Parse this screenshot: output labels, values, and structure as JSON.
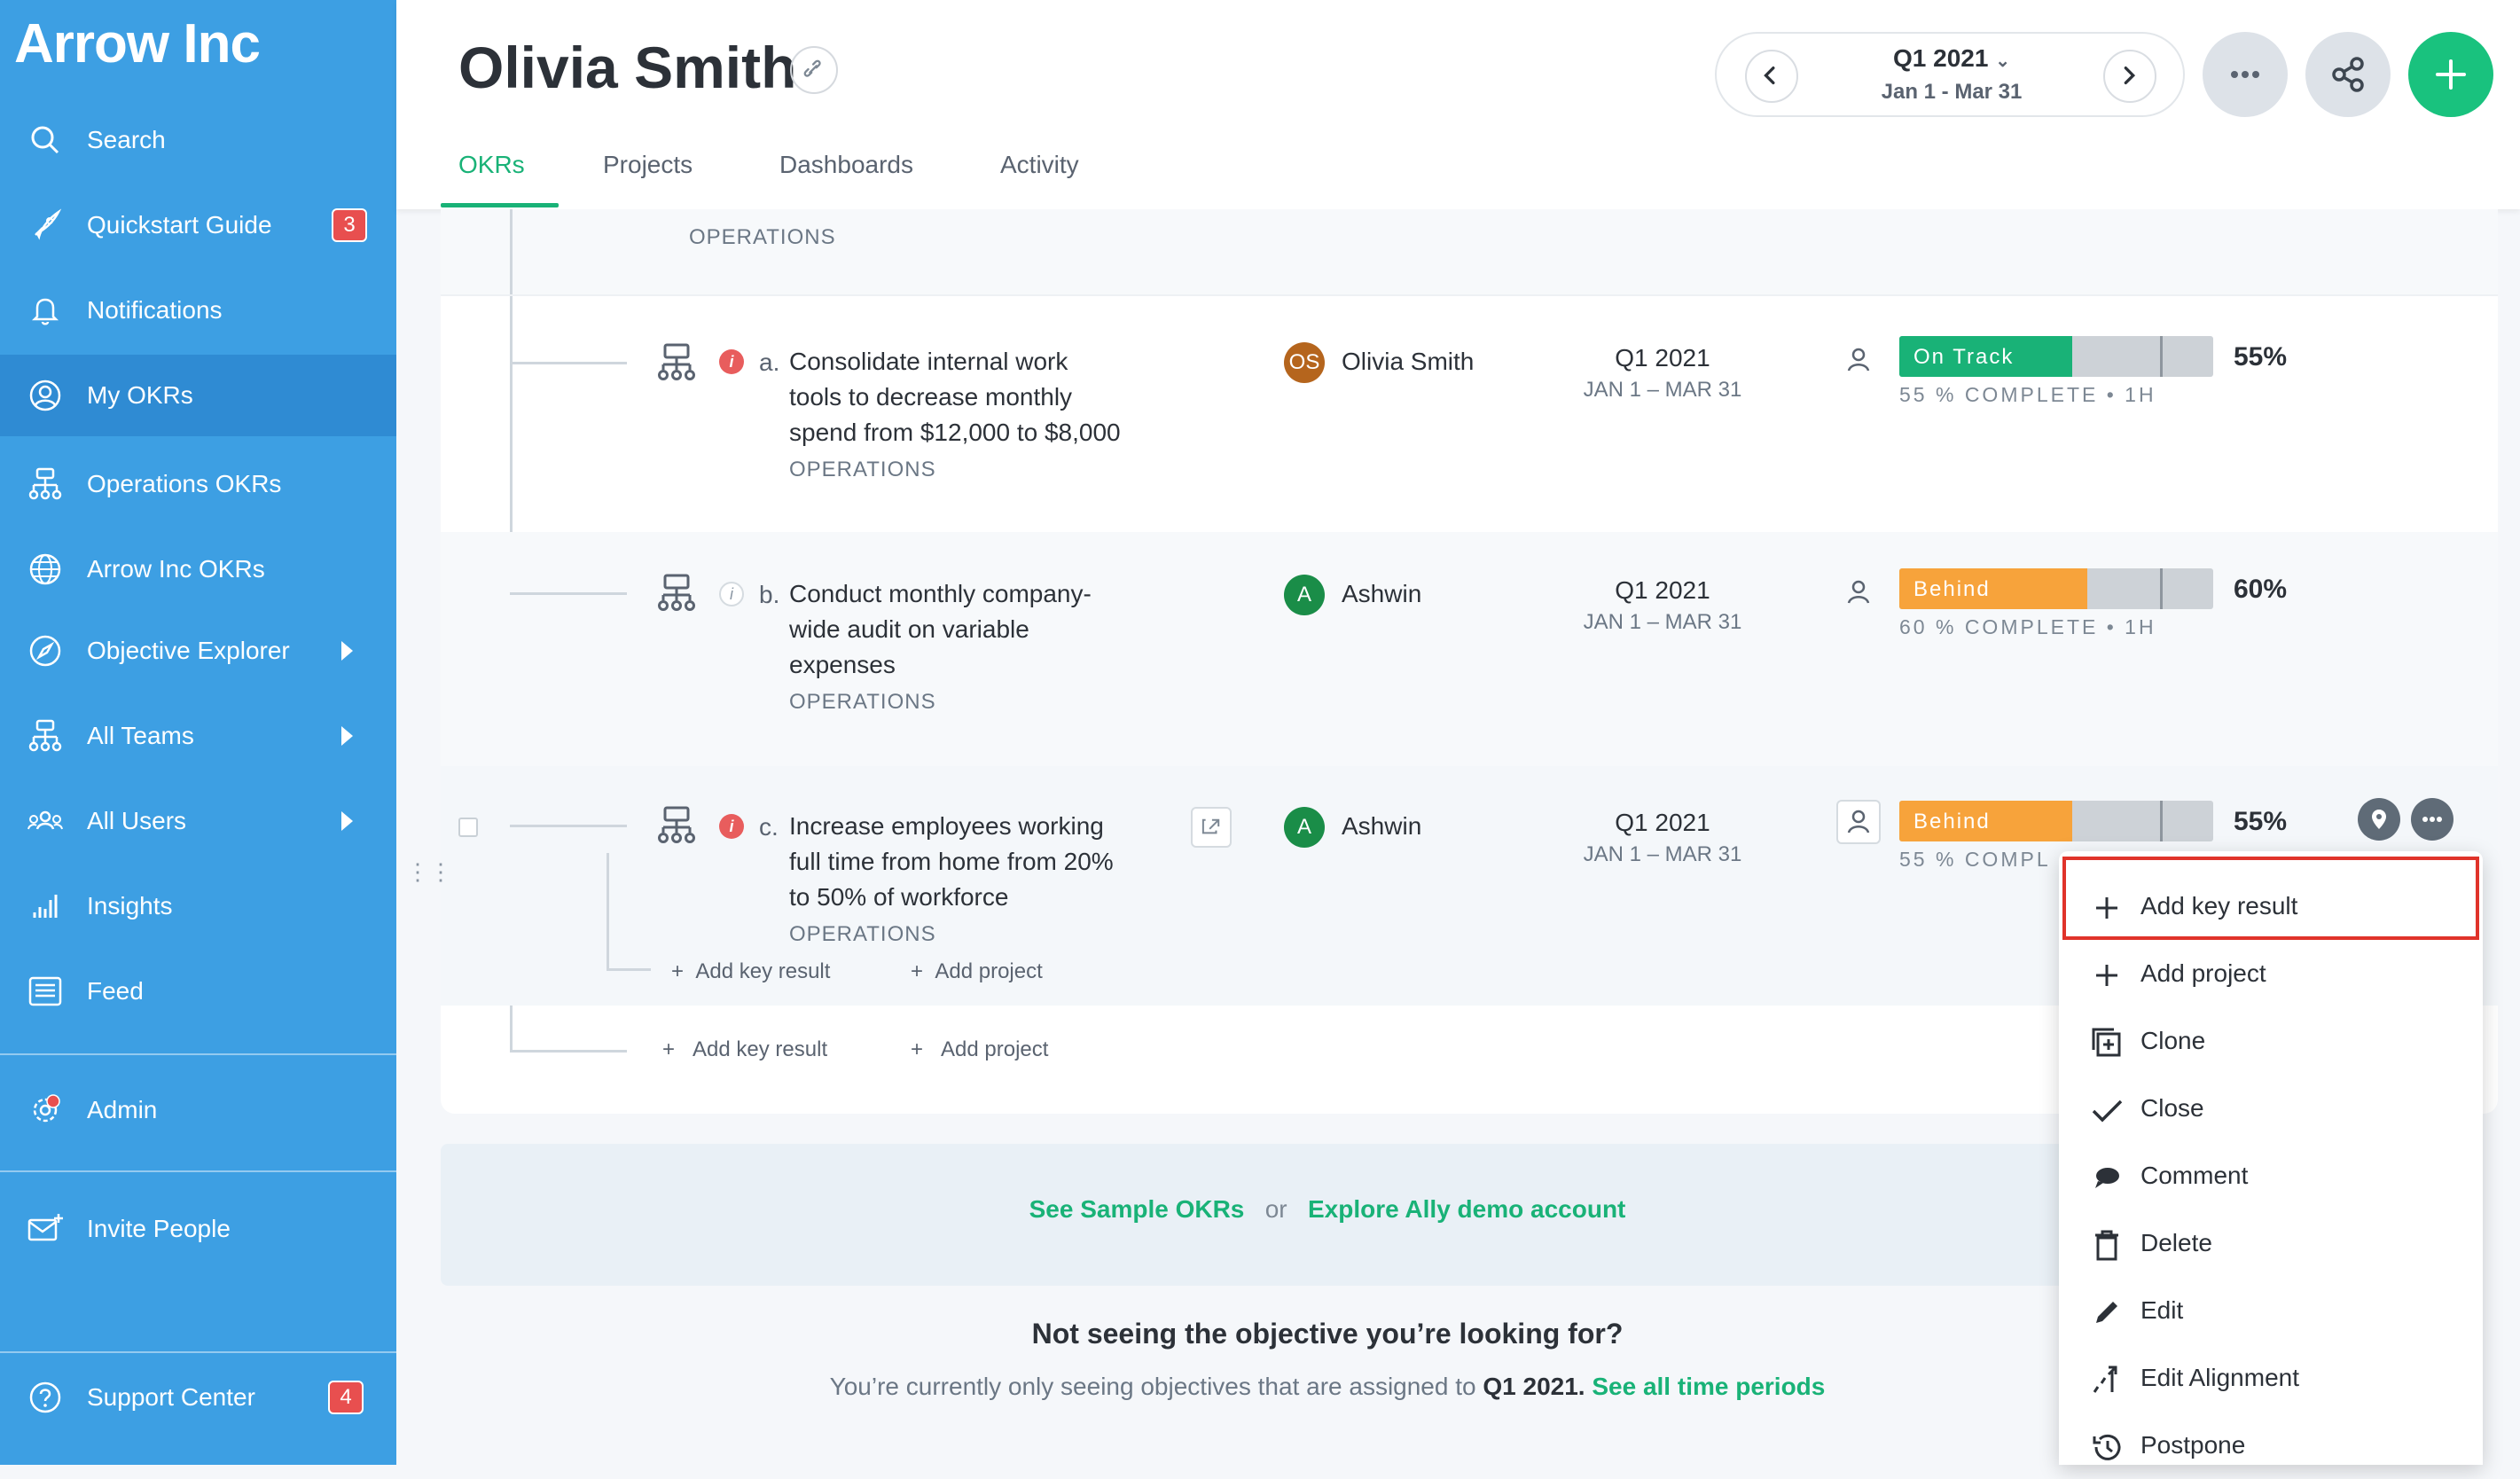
{
  "sidebar": {
    "brand": "Arrow Inc",
    "items": [
      {
        "label": "Search"
      },
      {
        "label": "Quickstart Guide",
        "badge": "3"
      },
      {
        "label": "Notifications"
      },
      {
        "label": "My OKRs"
      },
      {
        "label": "Operations OKRs"
      },
      {
        "label": "Arrow Inc OKRs"
      },
      {
        "label": "Objective Explorer"
      },
      {
        "label": "All Teams"
      },
      {
        "label": "All Users"
      },
      {
        "label": "Insights"
      },
      {
        "label": "Feed"
      },
      {
        "label": "Admin"
      },
      {
        "label": "Invite People"
      },
      {
        "label": "Support Center",
        "badge": "4"
      }
    ]
  },
  "header": {
    "title": "Olivia Smith",
    "tabs": [
      "OKRs",
      "Projects",
      "Dashboards",
      "Activity"
    ],
    "period": {
      "quarter": "Q1 2021",
      "range": "Jan 1 - Mar 31"
    }
  },
  "okrs": {
    "top_team": "OPERATIONS",
    "rows": [
      {
        "letter": "a.",
        "title_lines": [
          "Consolidate internal work",
          "tools to decrease monthly",
          "spend from $12,000 to $8,000"
        ],
        "team": "OPERATIONS",
        "owner": "Olivia Smith",
        "owner_initials": "OS",
        "quarter": "Q1 2021",
        "range": "JAN 1 – MAR 31",
        "status": "On Track",
        "progress": 0.55,
        "percent": "55%",
        "sub": "55 % COMPLETE • 1H"
      },
      {
        "letter": "b.",
        "title_lines": [
          "Conduct monthly company-",
          "wide audit on variable",
          "expenses"
        ],
        "team": "OPERATIONS",
        "owner": "Ashwin",
        "owner_initials": "A",
        "quarter": "Q1 2021",
        "range": "JAN 1 – MAR 31",
        "status": "Behind",
        "progress": 0.6,
        "percent": "60%",
        "sub": "60 % COMPLETE • 1H"
      },
      {
        "letter": "c.",
        "title_lines": [
          "Increase employees working",
          "full time from home from 20%",
          "to 50% of workforce"
        ],
        "team": "OPERATIONS",
        "owner": "Ashwin",
        "owner_initials": "A",
        "quarter": "Q1 2021",
        "range": "JAN 1 – MAR 31",
        "status": "Behind",
        "progress": 0.55,
        "percent": "55%",
        "sub": "55 % COMPL"
      }
    ],
    "add_key_result": "Add key result",
    "add_project": "Add project"
  },
  "promo": {
    "sample": "See Sample OKRs",
    "or": "or",
    "demo": "Explore Ally demo account"
  },
  "notice": {
    "heading": "Not seeing the objective you’re looking for?",
    "text": "You’re currently only seeing objectives that are assigned to",
    "period": "Q1 2021.",
    "link": "See all time periods"
  },
  "menu": {
    "items": [
      "Add key result",
      "Add project",
      "Clone",
      "Close",
      "Comment",
      "Delete",
      "Edit",
      "Edit Alignment",
      "Postpone"
    ]
  },
  "colors": {
    "sidebar": "#3d9fe3",
    "accent": "#19b277",
    "on_track": "#19b277",
    "behind": "#f7a33b",
    "alert": "#e84f4f"
  }
}
